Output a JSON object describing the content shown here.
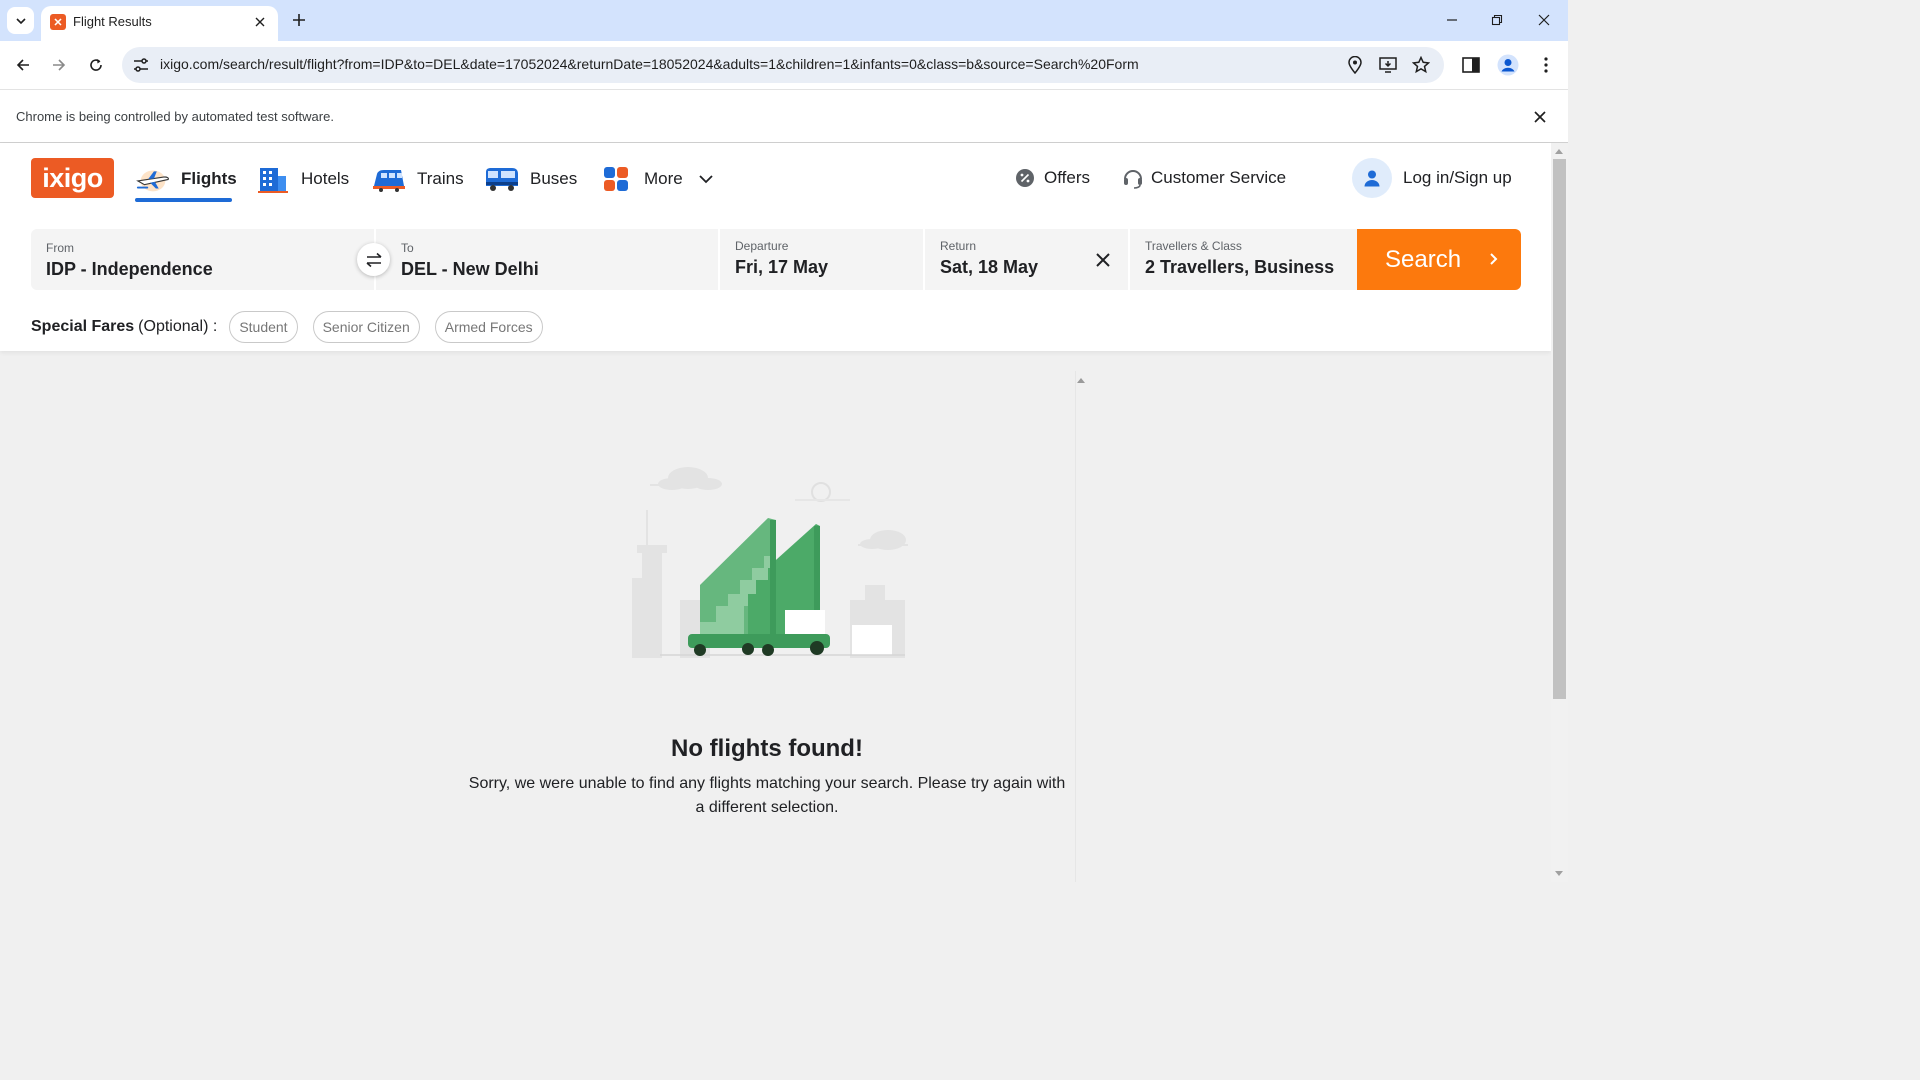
{
  "browser": {
    "tab_title": "Flight Results",
    "url": "ixigo.com/search/result/flight?from=IDP&to=DEL&date=17052024&returnDate=18052024&adults=1&children=1&infants=0&class=b&source=Search%20Form",
    "infobar_message": "Chrome is being controlled by automated test software."
  },
  "header": {
    "logo": "ixigo",
    "nav": [
      {
        "label": "Flights",
        "icon": "plane-icon"
      },
      {
        "label": "Hotels",
        "icon": "hotel-icon"
      },
      {
        "label": "Trains",
        "icon": "train-icon"
      },
      {
        "label": "Buses",
        "icon": "bus-icon"
      },
      {
        "label": "More",
        "icon": "grid-icon"
      }
    ],
    "offers": "Offers",
    "customer_service": "Customer Service",
    "login": "Log in/Sign up"
  },
  "search": {
    "from_label": "From",
    "from_value": "IDP - Independence",
    "to_label": "To",
    "to_value": "DEL - New Delhi",
    "departure_label": "Departure",
    "departure_value": "Fri, 17 May",
    "return_label": "Return",
    "return_value": "Sat, 18 May",
    "travellers_label": "Travellers & Class",
    "travellers_value": "2 Travellers, Business",
    "button": "Search"
  },
  "special_fares": {
    "title": "Special Fares",
    "optional": "(Optional) :",
    "chips": [
      "Student",
      "Senior Citizen",
      "Armed Forces"
    ]
  },
  "empty_state": {
    "title": "No flights found!",
    "message": "Sorry, we were unable to find any flights matching your search. Please try again with a different selection."
  },
  "colors": {
    "brand": "#ec5b24",
    "search_button": "#fc790d",
    "active_underline": "#1e6bd6",
    "illustration_green": "#3e9b5b"
  }
}
